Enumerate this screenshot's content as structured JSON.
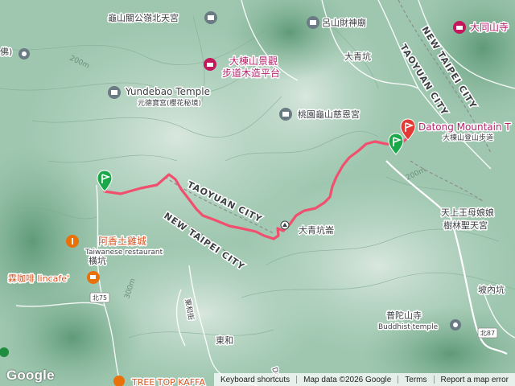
{
  "map": {
    "labels": {
      "guishan_palace": "龜山關公嶺北天宮",
      "lushan_temple": "呂山財神廟",
      "daqingkeng_top": "大青坑",
      "datong_temple": "大同山寺",
      "scenic_line1": "大棟山景觀",
      "scenic_line2": "步道木造平台",
      "yundebao_name": "Yundebao Temple",
      "yundebao_sub": "元德寶宮(櫻花秘境)",
      "cien_temple": "桃園龜山慈恩宮",
      "datong_trail_name": "Datong Mountain T",
      "datong_trail_sub": "大棟山登山步道",
      "daqingkeng_mid": "大青坑崙",
      "tianshang_line1": "天上王母娘娘",
      "tianshang_line2": "樹林聖天宮",
      "chicken_name": "阿香土雞城",
      "chicken_sub": "Taiwanese restaurant",
      "hengkeng": "橫坑",
      "cafe": "霖咖啡 lincafe'",
      "pohe": "坡內坑",
      "putuo_name": "普陀山寺",
      "putuo_sub": "Buddhist temple",
      "donghe": "東和",
      "dongli_st": "東和街",
      "treetop": "TREE TOP KAFFA",
      "fo": "佛)",
      "road_do": "Do",
      "contour_200": "200m",
      "contour_300": "300m"
    },
    "road_labels": {
      "new_taipei_top": "NEW TAIPEI CITY",
      "taoyuan_top": "TAOYUAN CITY",
      "taoyuan_mid": "TAOYUAN CITY",
      "new_taipei_mid": "NEW TAIPEI CITY"
    },
    "shields": {
      "bei75": "北75",
      "bei87": "北87"
    },
    "route": {
      "color": "#f0506e",
      "start_marker_color": "#1aa84a",
      "end_marker_color": "#e53935"
    }
  },
  "footer": {
    "logo": "Google",
    "keyboard": "Keyboard shortcuts",
    "data": "Map data ©2026 Google",
    "terms": "Terms",
    "report": "Report a map error"
  }
}
